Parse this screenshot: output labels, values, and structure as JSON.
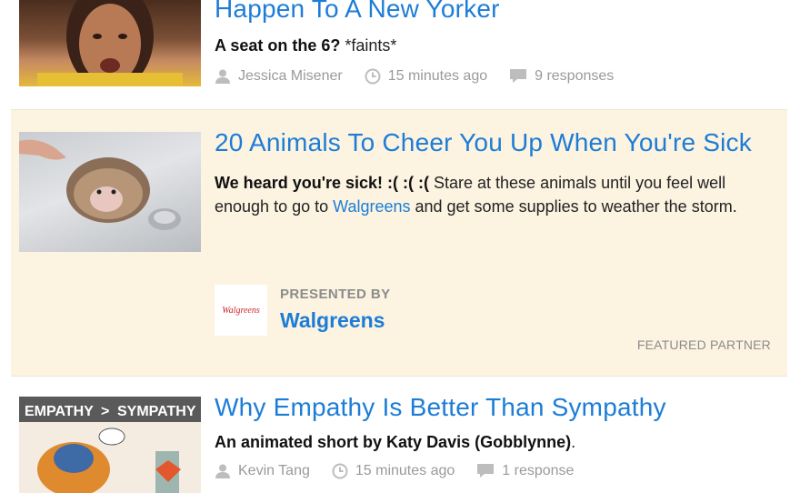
{
  "stories": [
    {
      "headline": "Happen To A New Yorker",
      "desc_bold": "A seat on the 6?",
      "desc_text": " *faints*",
      "author": "Jessica Misener",
      "time": "15 minutes ago",
      "responses": "9 responses"
    },
    {
      "headline": "20 Animals To Cheer You Up When You're Sick",
      "desc_bold": "We heard you're sick! :( :( :(",
      "desc_text1": " Stare at these animals until you feel well enough to go to ",
      "desc_link": "Walgreens",
      "desc_text2": " and get some supplies to weather the storm.",
      "presented_by": "PRESENTED BY",
      "partner_name": "Walgreens",
      "partner_logo_text": "Walgreens",
      "featured_label": "FEATURED PARTNER"
    },
    {
      "headline": "Why Empathy Is Better Than Sympathy",
      "thumb_banner_left": "EMPATHY",
      "thumb_banner_sign": ">",
      "thumb_banner_right": "SYMPATHY",
      "desc_bold": "An animated short by",
      "desc_link": "Katy Davis (Gobblynne)",
      "desc_tail": ".",
      "author": "Kevin Tang",
      "time": "15 minutes ago",
      "responses": "1 response"
    }
  ],
  "colors": {
    "link": "#1d7dd6",
    "featured_bg": "#fcf3e1",
    "meta": "#9a9a9a"
  }
}
